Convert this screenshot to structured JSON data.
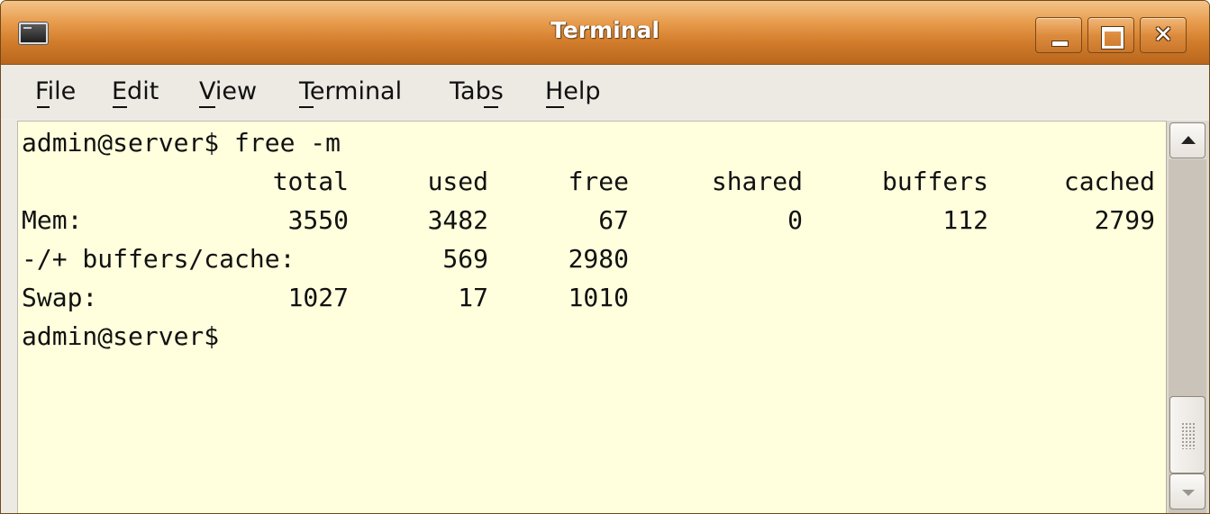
{
  "window": {
    "title": "Terminal",
    "icon": "terminal-icon"
  },
  "window_controls": {
    "minimize_glyph": "",
    "maximize_glyph": "",
    "close_glyph": "✕"
  },
  "menubar": {
    "items": [
      {
        "label": "File",
        "mnemonic": "F"
      },
      {
        "label": "Edit",
        "mnemonic": "E"
      },
      {
        "label": "View",
        "mnemonic": "V"
      },
      {
        "label": "Terminal",
        "mnemonic": "T"
      },
      {
        "label": "Tabs",
        "mnemonic": "b"
      },
      {
        "label": "Help",
        "mnemonic": "H"
      }
    ]
  },
  "terminal": {
    "background_color": "#ffffdd",
    "command_line": "admin@server$ free -m",
    "output": {
      "headers": [
        "total",
        "used",
        "free",
        "shared",
        "buffers",
        "cached"
      ],
      "rows": [
        {
          "label": "Mem:",
          "values": [
            "3550",
            "3482",
            "67",
            "0",
            "112",
            "2799"
          ]
        },
        {
          "label": "-/+ buffers/cache:",
          "values": [
            "",
            "569",
            "2980",
            "",
            "",
            ""
          ]
        },
        {
          "label": "Swap:",
          "values": [
            "1027",
            "17",
            "1010",
            "",
            "",
            ""
          ]
        }
      ]
    },
    "prompt": "admin@server$"
  },
  "scrollbar": {
    "up_icon": "arrow-up-icon",
    "down_icon": "arrow-down-icon"
  },
  "colors": {
    "titlebar_accent": "#d27d2c",
    "terminal_bg": "#ffffdd",
    "text": "#111111"
  }
}
